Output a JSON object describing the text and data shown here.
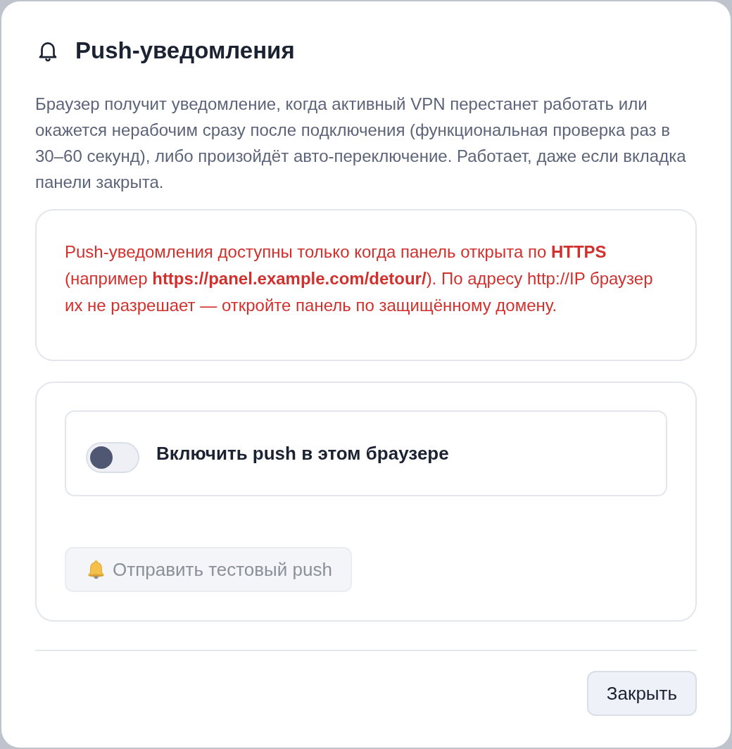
{
  "dialog": {
    "title": "Push-уведомления",
    "description": "Браузер получит уведомление, когда активный VPN перестанет работать или окажется нерабочим сразу после подключения (функциональная проверка раз в 30–60 секунд), либо произойдёт авто-переключение. Работает, даже если вкладка панели закрыта.",
    "warning": {
      "text": "Push-уведомления доступны только когда панель открыта по **HTTPS** (например **https://panel.example.com/detour/**). По адресу http://IP браузер их не разрешает — откройте панель по защищённому домену."
    },
    "push_toggle": {
      "label": "Включить push в этом браузере",
      "on": false
    },
    "test_button": {
      "label": "Отправить тестовый push",
      "disabled": true
    },
    "buttons": [
      {
        "label": "Закрыть"
      }
    ]
  }
}
